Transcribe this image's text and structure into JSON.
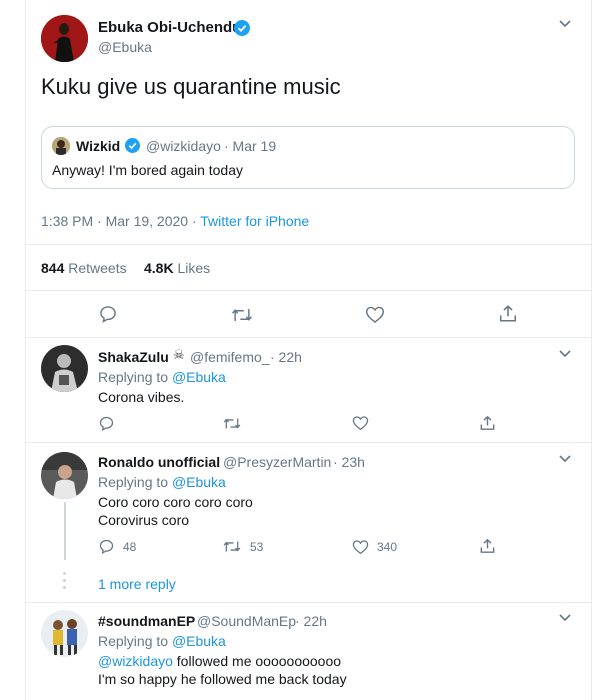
{
  "main_tweet": {
    "display_name": "Ebuka Obi-Uchendu",
    "handle": "@Ebuka",
    "text": "Kuku give us quarantine music",
    "quote": {
      "display_name": "Wizkid",
      "handle": "@wizkidayo",
      "date": "· Mar 19",
      "text": "Anyway! I'm bored again today"
    },
    "timestamp": "1:38 PM · Mar 19, 2020 · ",
    "source": "Twitter for iPhone",
    "retweets_count": "844",
    "retweets_label": "Retweets",
    "likes_count": "4.8K",
    "likes_label": "Likes"
  },
  "replies": [
    {
      "display_name": "ShakaZulu",
      "handle": "@femifemo_",
      "time": "· 22h",
      "replying_prefix": "Replying to ",
      "replying_to": "@Ebuka",
      "lines": [
        "Corona vibes."
      ],
      "reply_count": "",
      "retweet_count": "",
      "like_count": ""
    },
    {
      "display_name": "Ronaldo unofficial",
      "handle": "@PresyzerMartin",
      "time": "· 23h",
      "replying_prefix": "Replying to ",
      "replying_to": "@Ebuka",
      "lines": [
        "Coro coro coro coro coro",
        "Corovirus coro"
      ],
      "reply_count": "48",
      "retweet_count": "53",
      "like_count": "340",
      "more_replies": "1 more reply"
    },
    {
      "display_name": "#soundmanEP",
      "handle": "@SoundManEp",
      "time": "· 22h",
      "replying_prefix": "Replying to ",
      "replying_to": "@Ebuka",
      "mention": "@wizkidayo",
      "line1_rest": " followed me ooooooooooo",
      "line2": "I'm so happy he followed me back today"
    }
  ],
  "colors": {
    "accent_blue": "#1b95e0",
    "verified_blue": "#1da1f2",
    "text_primary": "#14171a",
    "text_secondary": "#657786",
    "divider": "#e6ecf0"
  },
  "icons": [
    "verified-badge-icon",
    "chevron-down-icon",
    "reply-icon",
    "retweet-icon",
    "like-icon",
    "share-icon",
    "dots-icon"
  ]
}
